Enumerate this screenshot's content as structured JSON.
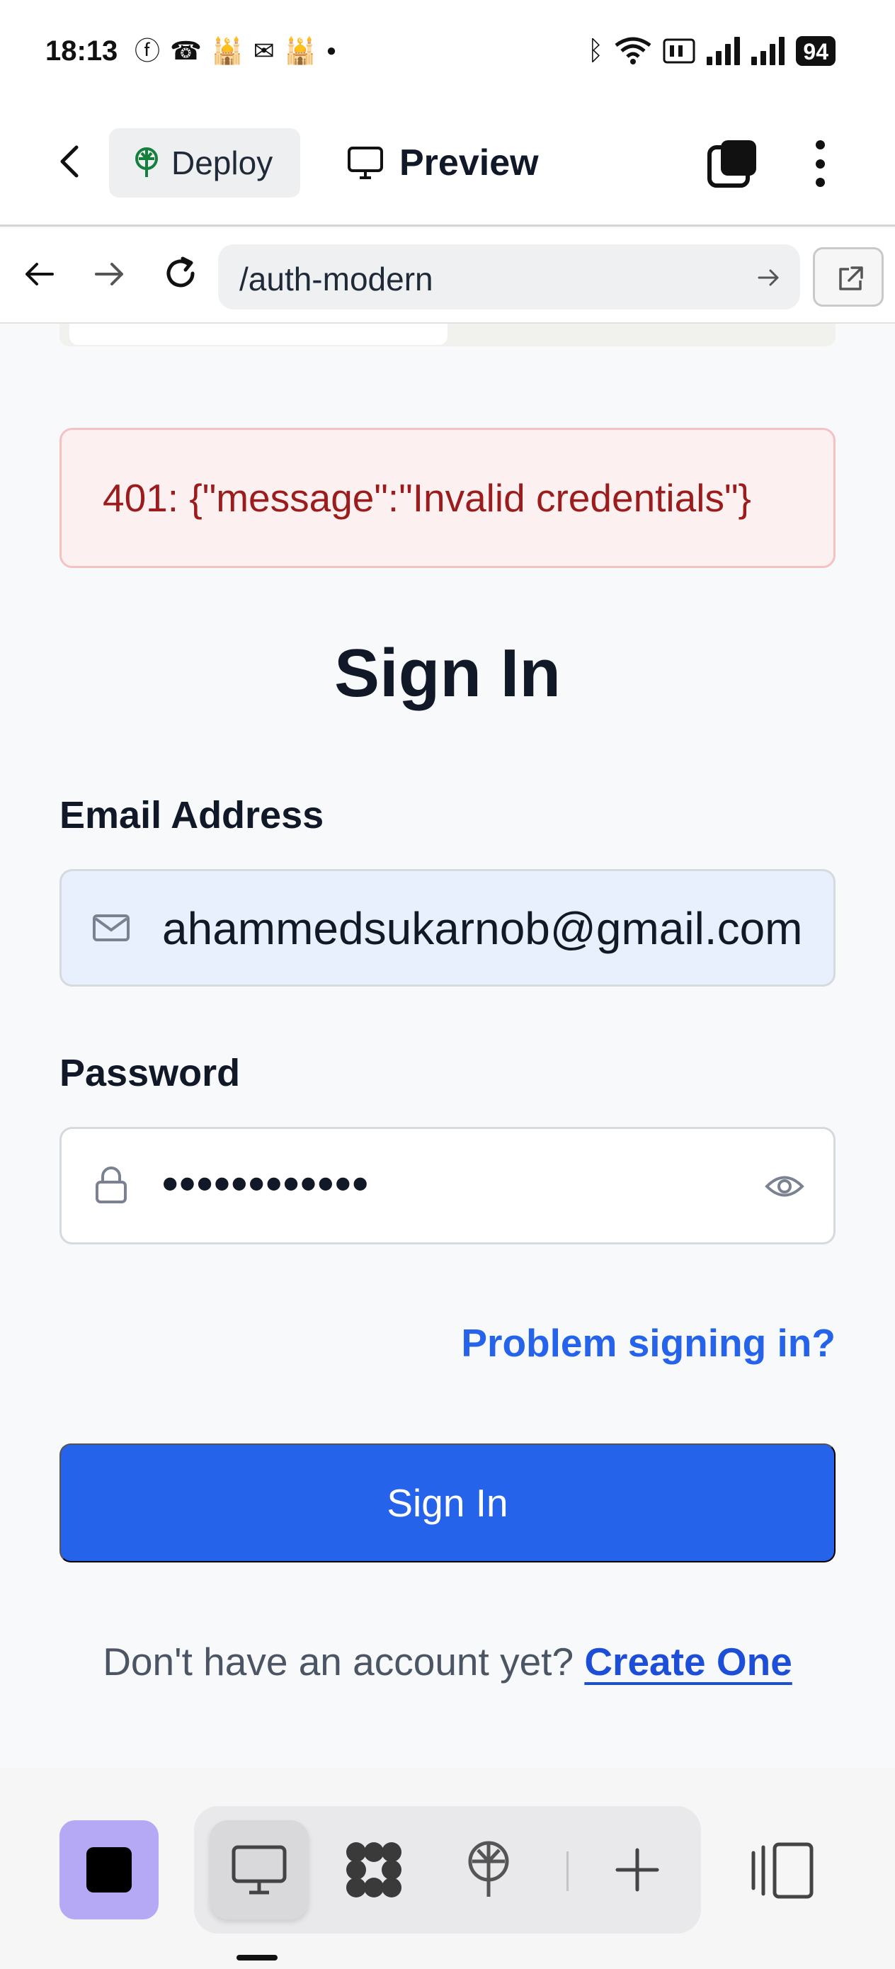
{
  "status_bar": {
    "time": "18:13",
    "notification_icons": [
      "facebook-icon",
      "missed-call-icon",
      "mosque-icon",
      "my-app-icon",
      "mosque-icon",
      "dot-icon"
    ],
    "battery": "94",
    "indicators": [
      "bluetooth-icon",
      "wifi-icon",
      "volte-icon",
      "signal-icon",
      "signal-icon"
    ]
  },
  "toolbar": {
    "deploy_label": "Deploy",
    "preview_label": "Preview"
  },
  "browser": {
    "url": "/auth-modern"
  },
  "page": {
    "error_message": "401: {\"message\":\"Invalid credentials\"}",
    "title": "Sign In",
    "email_label": "Email Address",
    "email_value": "ahammedsukarnob@gmail.com",
    "password_label": "Password",
    "password_value": "••••••••••••",
    "problem_link": "Problem signing in?",
    "submit_label": "Sign In",
    "signup_prompt": "Don't have an account yet?",
    "signup_link": "Create One"
  },
  "colors": {
    "accent": "#2563eb",
    "error_bg": "#fdf0f0",
    "error_text": "#9b1c1c",
    "autofill_bg": "#e8f0fe",
    "dock_accent": "#b5a8f5"
  }
}
